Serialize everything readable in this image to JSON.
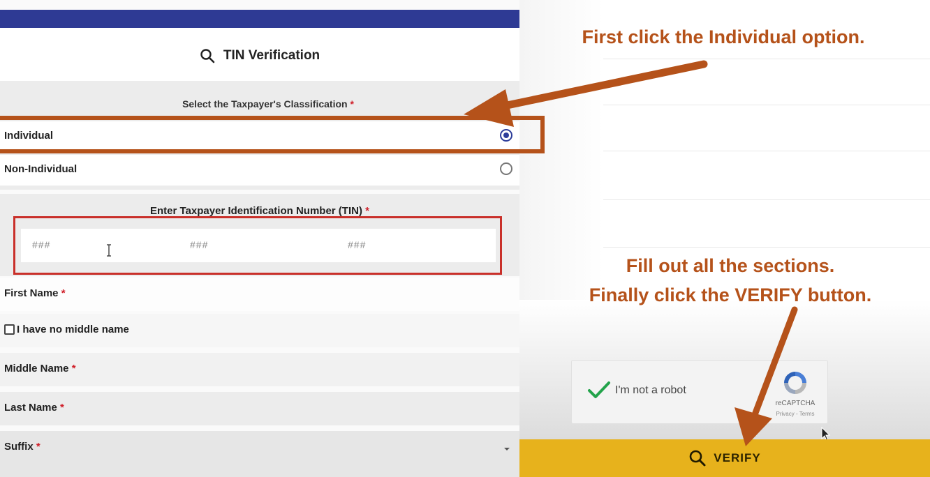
{
  "form": {
    "title": "TIN Verification",
    "classification_label": "Select the Taxpayer's Classification",
    "required_mark": "*",
    "options": [
      {
        "label": "Individual",
        "selected": true
      },
      {
        "label": "Non-Individual",
        "selected": false
      }
    ],
    "tin_label": "Enter Taxpayer Identification Number (TIN)",
    "tin_placeholders": [
      "###",
      "###",
      "###"
    ],
    "first_name_label": "First Name",
    "no_middle_name_label": "I have no middle name",
    "middle_name_label": "Middle Name",
    "last_name_label": "Last Name",
    "suffix_label": "Suffix"
  },
  "captcha": {
    "text": "I'm not a robot",
    "brand": "reCAPTCHA",
    "links": "Privacy - Terms"
  },
  "verify_button": {
    "label": "VERIFY"
  },
  "annotations": {
    "step1": "First click the Individual option.",
    "step2_line1": "Fill out all the sections.",
    "step2_line2": "Finally click the VERIFY button."
  },
  "colors": {
    "accent_orange": "#b5521a",
    "header_blue": "#2e3a94",
    "verify_yellow": "#e7b21c",
    "highlight_red": "#c9302a"
  }
}
